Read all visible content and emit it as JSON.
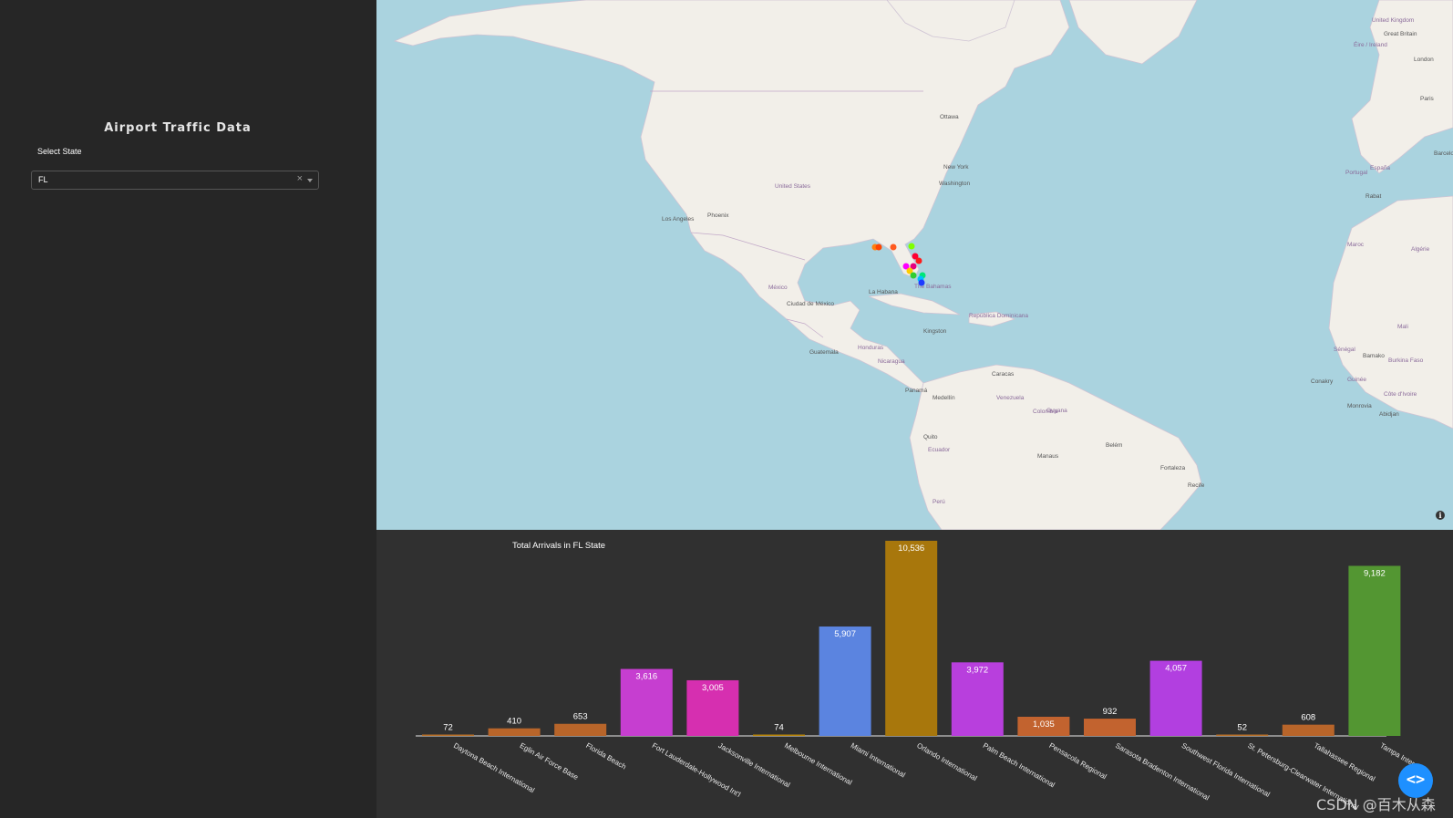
{
  "sidebar": {
    "title": "Airport Traffic Data",
    "select_label": "Select State",
    "select_value": "FL",
    "clear_symbol": "×"
  },
  "map": {
    "info_symbol": "i",
    "labels": [
      {
        "text": "United Kingdom"
      },
      {
        "text": "Great Britain"
      },
      {
        "text": "Éire / Ireland"
      },
      {
        "text": "London"
      },
      {
        "text": "Paris"
      },
      {
        "text": "Ottawa"
      },
      {
        "text": "New York"
      },
      {
        "text": "Washington"
      },
      {
        "text": "United States"
      },
      {
        "text": "Los Angeles"
      },
      {
        "text": "Phoenix"
      },
      {
        "text": "México"
      },
      {
        "text": "Ciudad de México"
      },
      {
        "text": "La Habana"
      },
      {
        "text": "The Bahamas"
      },
      {
        "text": "Kingston"
      },
      {
        "text": "República Dominicana"
      },
      {
        "text": "Guatemala"
      },
      {
        "text": "Honduras"
      },
      {
        "text": "Nicaragua"
      },
      {
        "text": "Panamá"
      },
      {
        "text": "Caracas"
      },
      {
        "text": "Venezuela"
      },
      {
        "text": "Medellín"
      },
      {
        "text": "Colombia"
      },
      {
        "text": "Guyana"
      },
      {
        "text": "Quito"
      },
      {
        "text": "Ecuador"
      },
      {
        "text": "Manaus"
      },
      {
        "text": "Belém"
      },
      {
        "text": "Fortaleza"
      },
      {
        "text": "Recife"
      },
      {
        "text": "Perú"
      },
      {
        "text": "Portugal"
      },
      {
        "text": "España"
      },
      {
        "text": "Rabat"
      },
      {
        "text": "Maroc"
      },
      {
        "text": "Barcelona"
      },
      {
        "text": "Algérie"
      },
      {
        "text": "Mali"
      },
      {
        "text": "Sénégal"
      },
      {
        "text": "Bamako"
      },
      {
        "text": "Burkina Faso"
      },
      {
        "text": "Guinée"
      },
      {
        "text": "Côte d'Ivoire"
      },
      {
        "text": "Conakry"
      },
      {
        "text": "Monrovia"
      },
      {
        "text": "Abidjan"
      }
    ],
    "markers": [
      {
        "color": "#ff7f0e"
      },
      {
        "color": "#ff4500"
      },
      {
        "color": "#ff5a1f"
      },
      {
        "color": "#7fff00"
      },
      {
        "color": "#ff0033"
      },
      {
        "color": "#ff1a1a"
      },
      {
        "color": "#e6007e"
      },
      {
        "color": "#ff00ff"
      },
      {
        "color": "#ffcc00"
      },
      {
        "color": "#32cd32"
      },
      {
        "color": "#00e676"
      },
      {
        "color": "#00bfff"
      },
      {
        "color": "#1e3cff"
      }
    ]
  },
  "chart_data": {
    "type": "bar",
    "title": "Total Arrivals in FL State",
    "categories": [
      "Daytona Beach International",
      "Eglin Air Force Base",
      "Florida Beach",
      "Fort Lauderdale-Hollywood Int'l",
      "Jacksonville International",
      "Melbourne International",
      "Miami International",
      "Orlando International",
      "Palm Beach International",
      "Pensacola Regional",
      "Sarasota Bradenton International",
      "Southwest Florida International",
      "St. Petersburg-Clearwater International",
      "Tallahassee Regional",
      "Tampa International"
    ],
    "visible_category_labels": [
      "Daytona Beach International",
      "Eglin Air Force Base",
      "Florida Beach",
      "Fort Lauderdale-Hollywood Int'l",
      "Jacksonville International",
      "Melbourne International",
      "Miami International",
      "Orlando International",
      "Palm Beach International",
      "Pensacola Regional",
      "Sarasota Bradenton International",
      "Southwest Florida International",
      "St. Petersburg-Clearwater International",
      "Tallahassee Regional",
      "Tampa Inter"
    ],
    "values": [
      72,
      410,
      653,
      3616,
      3005,
      74,
      5907,
      10536,
      3972,
      1035,
      932,
      4057,
      52,
      608,
      9182
    ],
    "value_labels": [
      "72",
      "410",
      "653",
      "3,616",
      "3,005",
      "74",
      "5,907",
      "10,536",
      "3,972",
      "1,035",
      "932",
      "4,057",
      "52",
      "608",
      "9,182"
    ],
    "colors": [
      "#b9712a",
      "#b8652a",
      "#b8652a",
      "#c63ed0",
      "#d62fb0",
      "#b8860b",
      "#5b84e0",
      "#a8770c",
      "#b83fdd",
      "#c2632f",
      "#c2632f",
      "#b23fe0",
      "#b9712a",
      "#b8652a",
      "#539632"
    ],
    "ylim": [
      0,
      10536
    ],
    "grid": false,
    "legend": false
  },
  "watermark": "CSDN @百木从森",
  "code_button_symbol": "<>"
}
